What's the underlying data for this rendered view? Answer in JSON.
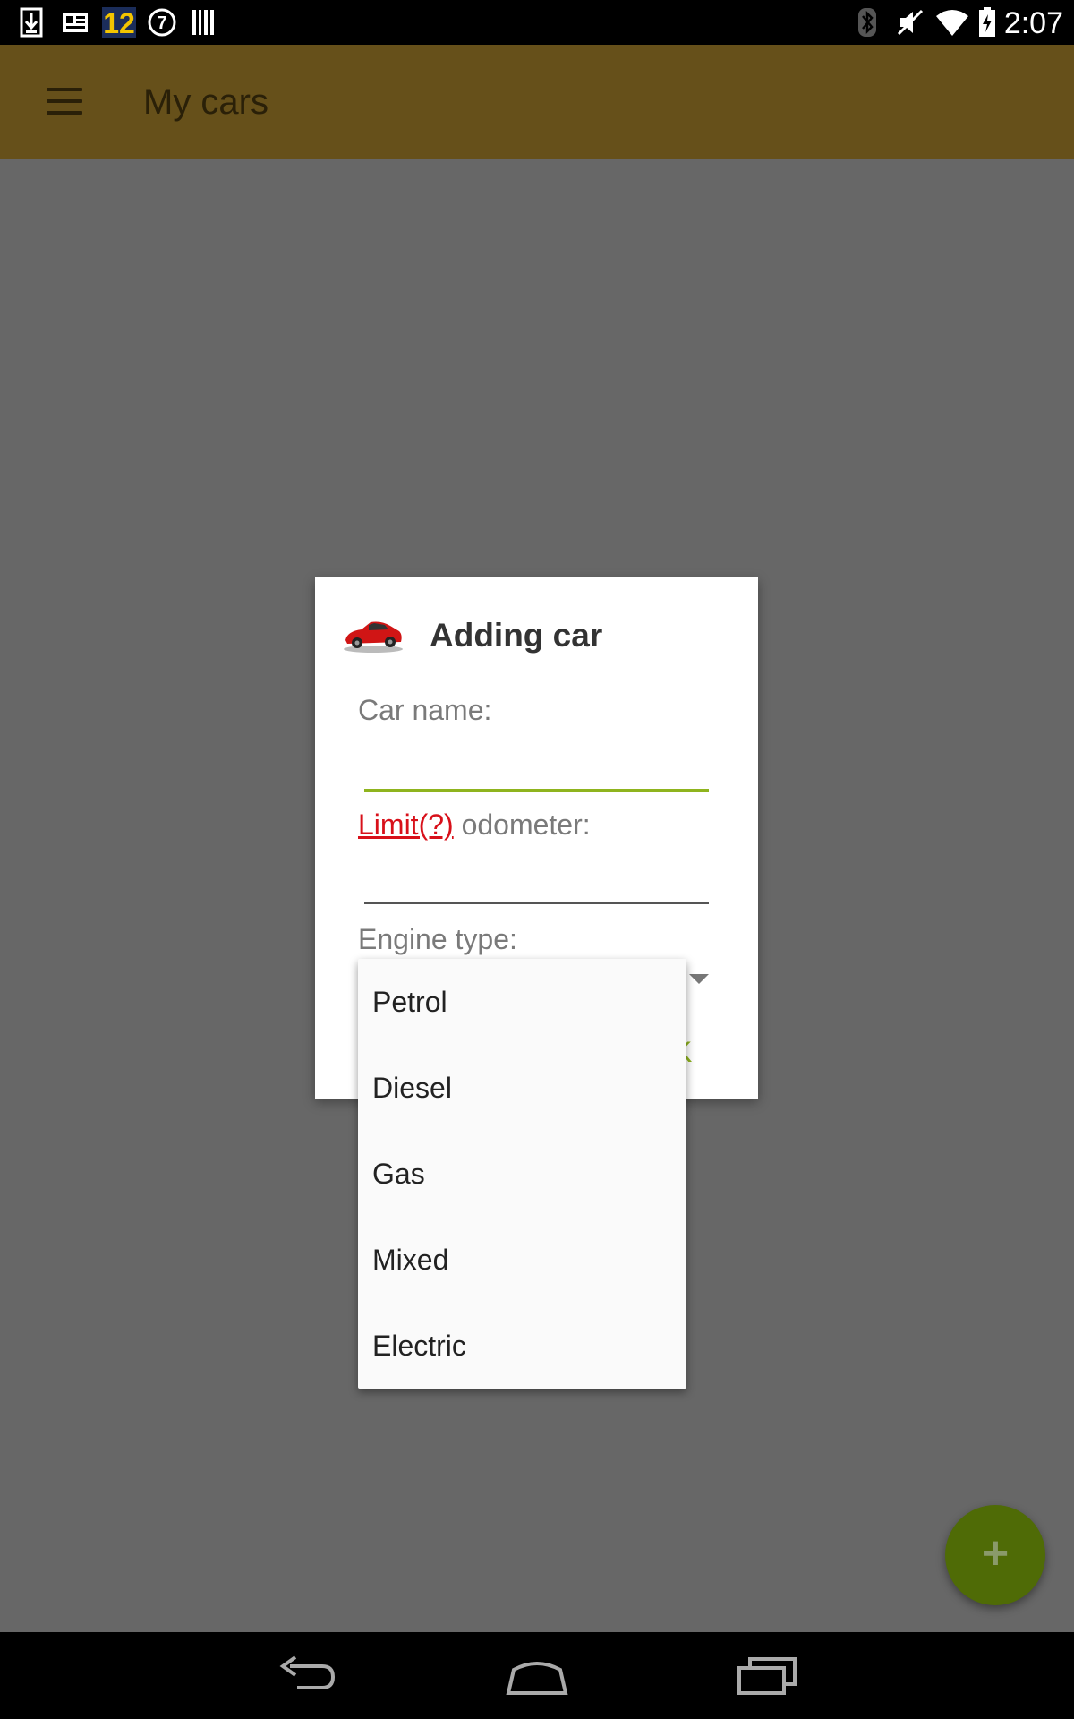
{
  "status_bar": {
    "time": "2:07",
    "left_icons": [
      "download-icon",
      "news-icon",
      "channel-12-icon",
      "abc7-icon",
      "barcode-icon"
    ],
    "right_icons": [
      "bluetooth-icon",
      "mute-icon",
      "wifi-icon",
      "battery-icon"
    ]
  },
  "app_bar": {
    "title": "My cars",
    "menu_icon": "hamburger-menu-icon",
    "color": "#66501a"
  },
  "dialog": {
    "title": "Adding car",
    "icon": "red-car-icon",
    "car_name_label": "Car name:",
    "car_name_value": "",
    "limit_link": "Limit(?)",
    "odometer_label": " odometer:",
    "odometer_value": "",
    "engine_type_label": "Engine type:",
    "ok_label": "K"
  },
  "dropdown": {
    "options": [
      "Petrol",
      "Diesel",
      "Gas",
      "Mixed",
      "Electric"
    ]
  },
  "fab": {
    "label": "+",
    "color": "#4f6b06"
  },
  "nav_bar": {
    "icons": [
      "back-icon",
      "home-icon",
      "recents-icon"
    ]
  },
  "colors": {
    "accent": "#8fb41e",
    "link": "#d8101a",
    "scrim": "#676767"
  }
}
